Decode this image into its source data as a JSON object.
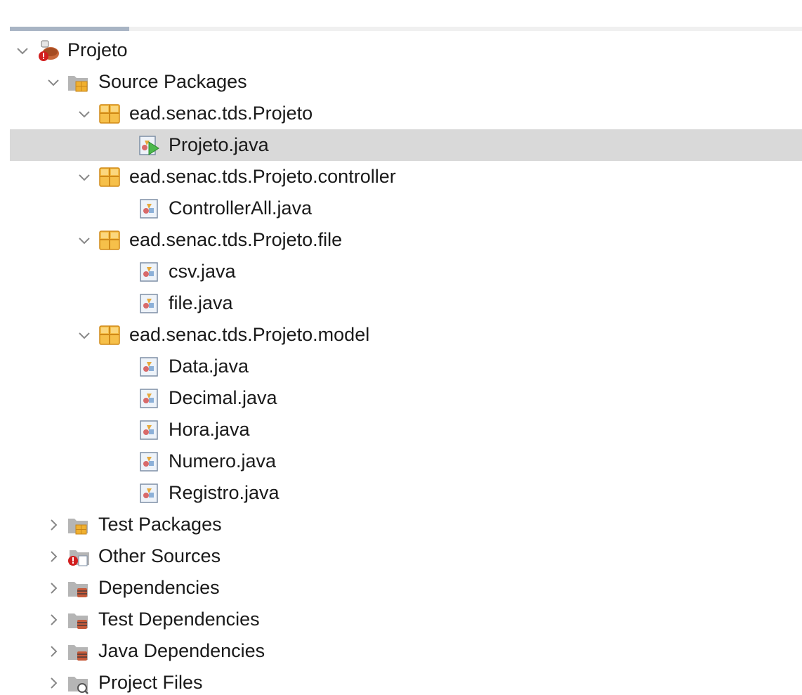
{
  "tree": {
    "root": {
      "label": "Projeto",
      "expanded": true
    },
    "source_packages": {
      "label": "Source Packages",
      "expanded": true
    },
    "packages": [
      {
        "label": "ead.senac.tds.Projeto",
        "expanded": true,
        "files": [
          {
            "label": "Projeto.java",
            "selected": true,
            "icon": "java-main-class-icon"
          }
        ]
      },
      {
        "label": "ead.senac.tds.Projeto.controller",
        "expanded": true,
        "files": [
          {
            "label": "ControllerAll.java",
            "icon": "java-class-icon"
          }
        ]
      },
      {
        "label": "ead.senac.tds.Projeto.file",
        "expanded": true,
        "files": [
          {
            "label": "csv.java",
            "icon": "java-class-icon"
          },
          {
            "label": "file.java",
            "icon": "java-class-icon"
          }
        ]
      },
      {
        "label": "ead.senac.tds.Projeto.model",
        "expanded": true,
        "files": [
          {
            "label": "Data.java",
            "icon": "java-class-icon"
          },
          {
            "label": "Decimal.java",
            "icon": "java-class-icon"
          },
          {
            "label": "Hora.java",
            "icon": "java-class-icon"
          },
          {
            "label": "Numero.java",
            "icon": "java-class-icon"
          },
          {
            "label": "Registro.java",
            "icon": "java-class-icon"
          }
        ]
      }
    ],
    "collapsed_nodes": [
      {
        "label": "Test Packages",
        "icon": "test-packages-folder-icon"
      },
      {
        "label": "Other Sources",
        "icon": "other-sources-folder-icon"
      },
      {
        "label": "Dependencies",
        "icon": "dependencies-folder-icon"
      },
      {
        "label": "Test Dependencies",
        "icon": "test-dependencies-folder-icon"
      },
      {
        "label": "Java Dependencies",
        "icon": "java-dependencies-folder-icon"
      },
      {
        "label": "Project Files",
        "icon": "project-files-folder-icon"
      }
    ]
  },
  "colors": {
    "selection": "#d9d9d9",
    "package_orange": "#f0b030",
    "folder_gray": "#a9a9a9",
    "chevron_gray": "#888888"
  }
}
